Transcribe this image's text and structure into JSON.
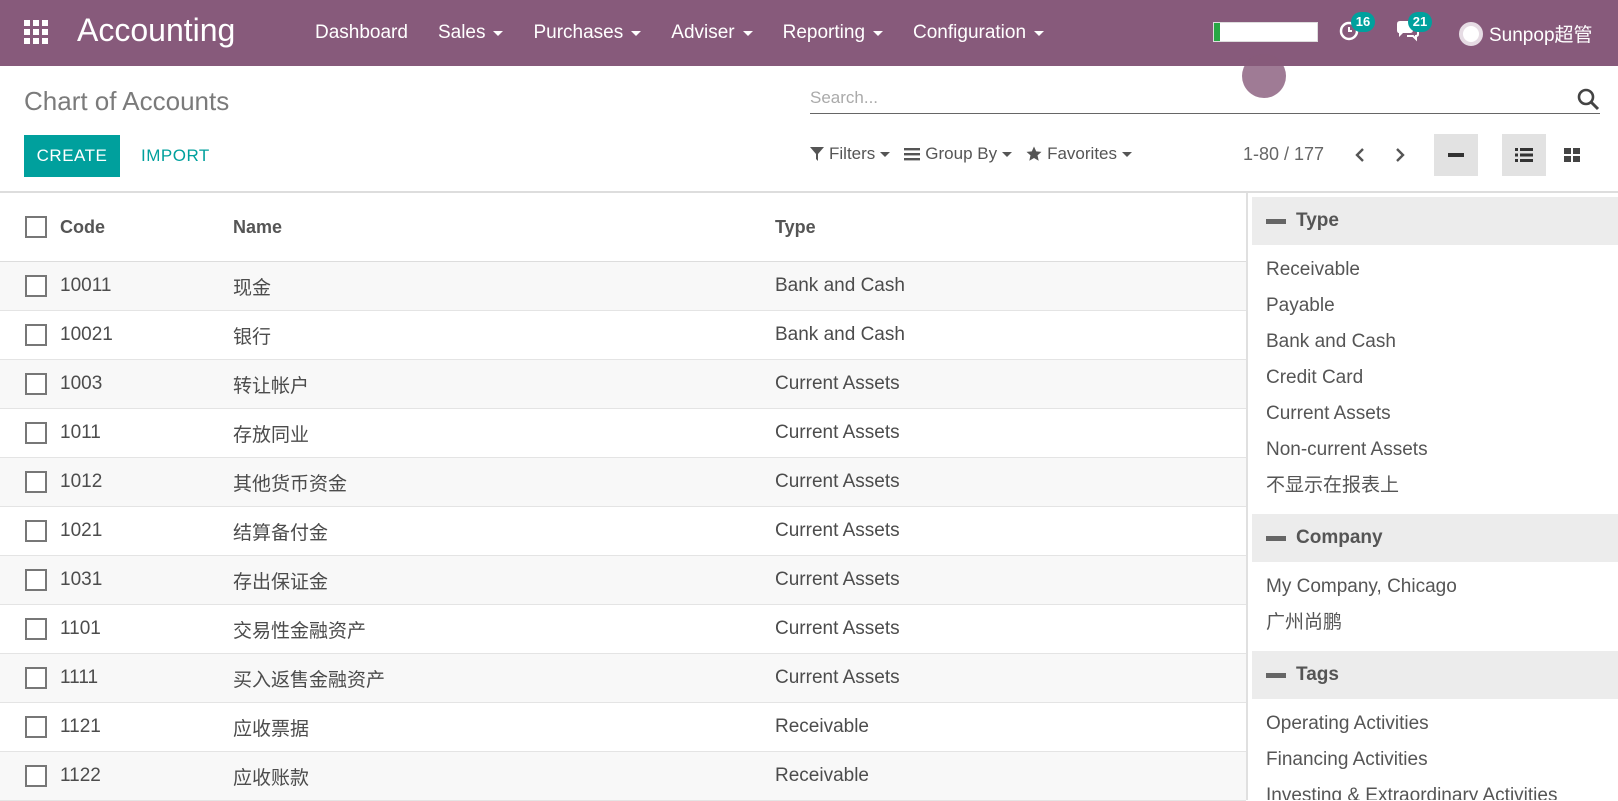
{
  "navbar": {
    "app_title": "Accounting",
    "menu": [
      {
        "label": "Dashboard",
        "dropdown": false
      },
      {
        "label": "Sales",
        "dropdown": true
      },
      {
        "label": "Purchases",
        "dropdown": true
      },
      {
        "label": "Adviser",
        "dropdown": true
      },
      {
        "label": "Reporting",
        "dropdown": true
      },
      {
        "label": "Configuration",
        "dropdown": true
      }
    ],
    "activity_count": "16",
    "message_count": "21",
    "user_name": "Sunpop超管",
    "progress_fraction": 0.06,
    "colors": {
      "bar": "#875a7b",
      "accent": "#00a09d"
    }
  },
  "control_panel": {
    "title": "Chart of Accounts",
    "search_placeholder": "Search...",
    "create_label": "CREATE",
    "import_label": "IMPORT",
    "filters_label": "Filters",
    "groupby_label": "Group By",
    "favorites_label": "Favorites",
    "pager": "1-80 / 177"
  },
  "table": {
    "headers": {
      "code": "Code",
      "name": "Name",
      "type": "Type"
    },
    "rows": [
      {
        "code": "10011",
        "name": "现金",
        "type": "Bank and Cash"
      },
      {
        "code": "10021",
        "name": "银行",
        "type": "Bank and Cash"
      },
      {
        "code": "1003",
        "name": "转让帐户",
        "type": "Current Assets"
      },
      {
        "code": "1011",
        "name": "存放同业",
        "type": "Current Assets"
      },
      {
        "code": "1012",
        "name": "其他货币资金",
        "type": "Current Assets"
      },
      {
        "code": "1021",
        "name": "结算备付金",
        "type": "Current Assets"
      },
      {
        "code": "1031",
        "name": "存出保证金",
        "type": "Current Assets"
      },
      {
        "code": "1101",
        "name": "交易性金融资产",
        "type": "Current Assets"
      },
      {
        "code": "1111",
        "name": "买入返售金融资产",
        "type": "Current Assets"
      },
      {
        "code": "1121",
        "name": "应收票据",
        "type": "Receivable"
      },
      {
        "code": "1122",
        "name": "应收账款",
        "type": "Receivable"
      }
    ]
  },
  "side_panel": {
    "sections": [
      {
        "title": "Type",
        "options": [
          "Receivable",
          "Payable",
          "Bank and Cash",
          "Credit Card",
          "Current Assets",
          "Non-current Assets",
          "不显示在报表上"
        ]
      },
      {
        "title": "Company",
        "options": [
          "My Company, Chicago",
          "广州尚鹏"
        ]
      },
      {
        "title": "Tags",
        "options": [
          "Operating Activities",
          "Financing Activities",
          "Investing & Extraordinary Activities"
        ]
      }
    ]
  }
}
